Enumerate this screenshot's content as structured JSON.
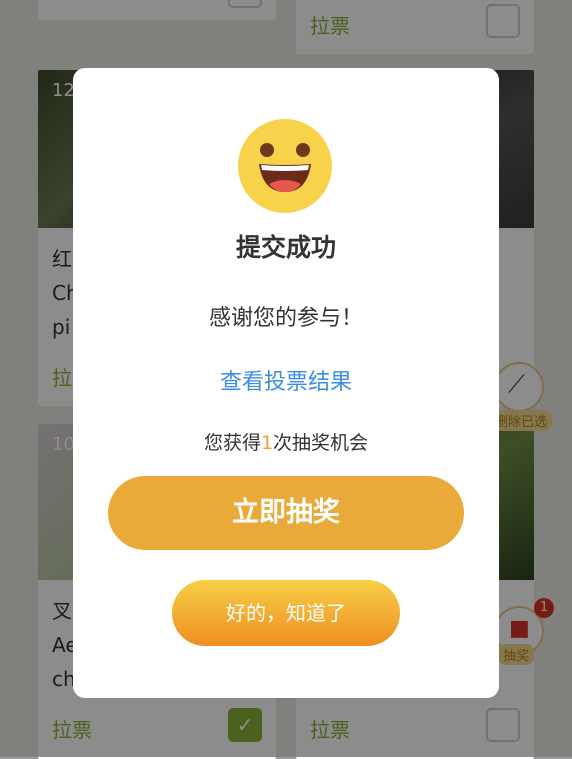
{
  "background": {
    "cards": [
      {
        "id": "top-left",
        "vote": ""
      },
      {
        "id": "top-right",
        "vote": "拉票"
      },
      {
        "id": "mid-left",
        "number": "12",
        "title_lines": [
          "红",
          "Ch",
          "pi"
        ],
        "vote": "拉"
      },
      {
        "id": "bottom-left",
        "number": "10",
        "title_lines": [
          "叉",
          "Ae",
          "ch"
        ],
        "vote": "拉票"
      },
      {
        "id": "bottom-right",
        "vote": "拉票"
      }
    ],
    "float_clear_label": "删除已选",
    "float_lottery_label": "抽奖",
    "lottery_badge": "1"
  },
  "modal": {
    "title": "提交成功",
    "thanks": "感谢您的参与！",
    "view_results_link": "查看投票结果",
    "chance_prefix": "您获得",
    "chance_count": "1",
    "chance_suffix": "次抽奖机会",
    "draw_button": "立即抽奖",
    "ok_button": "好的，知道了"
  },
  "colors": {
    "vote_green": "#8bb13a",
    "link_blue": "#3a8ee6",
    "draw_button": "#eaaa3a",
    "ok_gradient_top": "#f7cf46",
    "ok_gradient_bottom": "#ef8f22",
    "highlight_orange": "#f0a32a"
  }
}
